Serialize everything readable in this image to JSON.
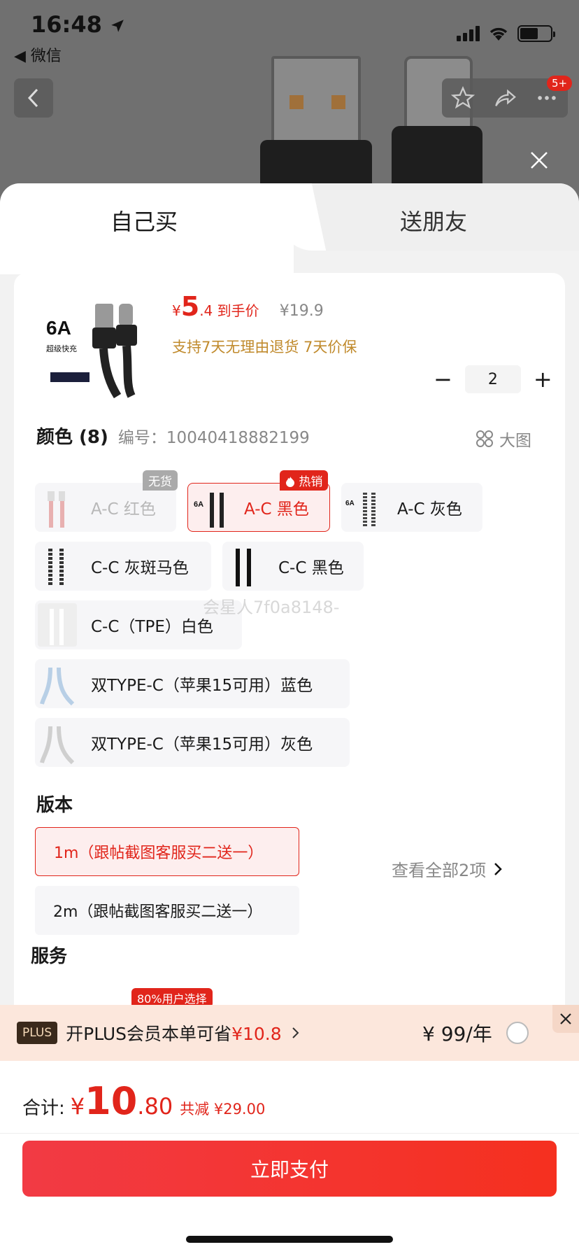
{
  "status_bar": {
    "time": "16:48",
    "back_app": "◀ 微信"
  },
  "nav": {
    "badge_count": "5+"
  },
  "tabs": [
    {
      "label": "自己买",
      "active": true
    },
    {
      "label": "送朋友",
      "active": false
    }
  ],
  "product": {
    "price_symbol": "¥",
    "price_int": "5",
    "price_dec": ".4",
    "price_label": "到手价",
    "original_price": "¥19.9",
    "promises": "支持7天无理由退货   7天价保",
    "quantity": "2",
    "thumb_text": "6A",
    "thumb_sub": "超级快充"
  },
  "color_section": {
    "title": "颜色 (8)",
    "code": "编号：10040418882199",
    "big_pic": "大图",
    "options": [
      {
        "label": "A-C 红色",
        "state": "disabled",
        "tag": "无货"
      },
      {
        "label": "A-C 黑色",
        "state": "selected",
        "tag": "热销"
      },
      {
        "label": "A-C 灰色",
        "state": "normal"
      },
      {
        "label": "C-C 灰斑马色",
        "state": "normal"
      },
      {
        "label": "C-C 黑色",
        "state": "normal"
      },
      {
        "label": "C-C（TPE）白色",
        "state": "normal"
      },
      {
        "label": "双TYPE-C（苹果15可用）蓝色",
        "state": "normal"
      },
      {
        "label": "双TYPE-C（苹果15可用）灰色",
        "state": "normal"
      }
    ]
  },
  "version_section": {
    "title": "版本",
    "options": [
      {
        "label": "1m（跟帖截图客服买二送一）",
        "state": "selected"
      },
      {
        "label": "2m（跟帖截图客服买二送一）",
        "state": "normal"
      }
    ]
  },
  "service_section": {
    "title": "服务",
    "more": "查看全部2项",
    "tag": "80%用户选择"
  },
  "watermark": "会星人7f0a8148-",
  "plus_bar": {
    "badge": "PLUS",
    "text_prefix": "开PLUS会员本单可省",
    "save_amount": "¥10.8",
    "price": "¥ 99/年"
  },
  "total": {
    "label": "合计:",
    "yen": "¥",
    "int": "10",
    "dec": ".80",
    "save": "共减 ¥29.00"
  },
  "pay_button": "立即支付",
  "colors": {
    "accent": "#e1251b",
    "gold": "#c08a2c"
  }
}
